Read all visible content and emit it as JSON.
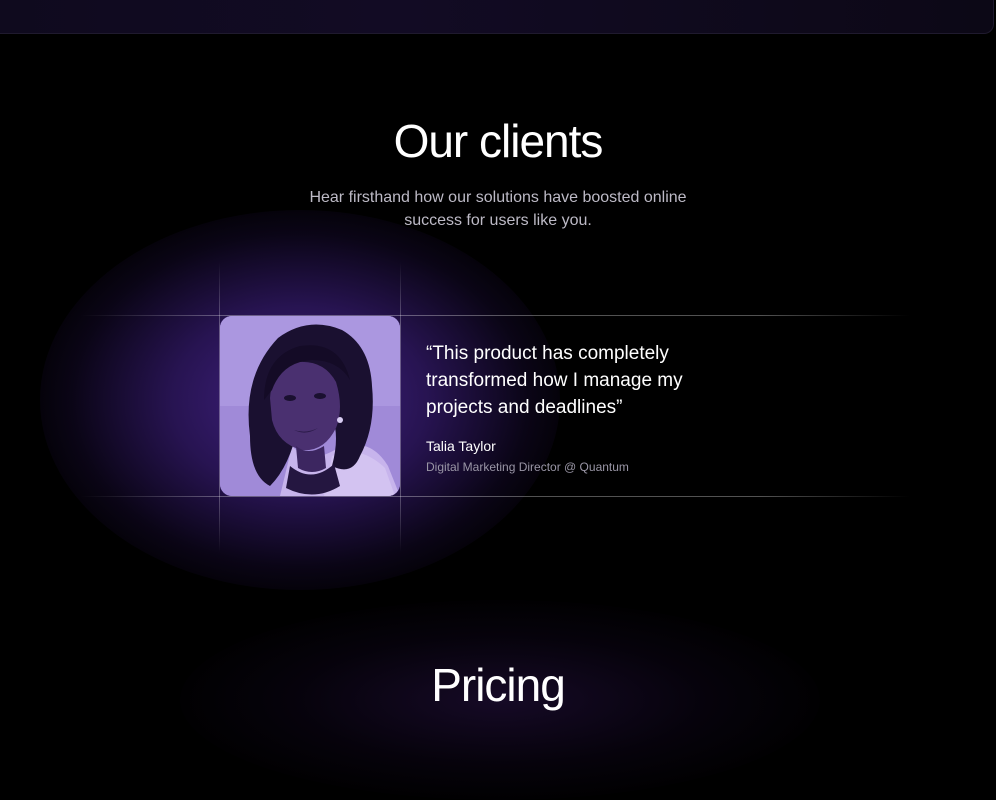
{
  "clients_section": {
    "title": "Our clients",
    "subtitle": "Hear firsthand how our solutions have boosted online success for users like you."
  },
  "testimonial": {
    "quote": "“This product has completely transformed how I manage my projects and deadlines”",
    "author_name": "Talia Taylor",
    "author_role": "Digital Marketing Director @ Quantum"
  },
  "next_section": {
    "title": "Pricing"
  },
  "colors": {
    "background": "#000000",
    "accent_purple": "#46248c",
    "avatar_tint": "#9c84d8",
    "subtitle_text": "#bdbac6",
    "muted_text": "#9a96a6"
  }
}
